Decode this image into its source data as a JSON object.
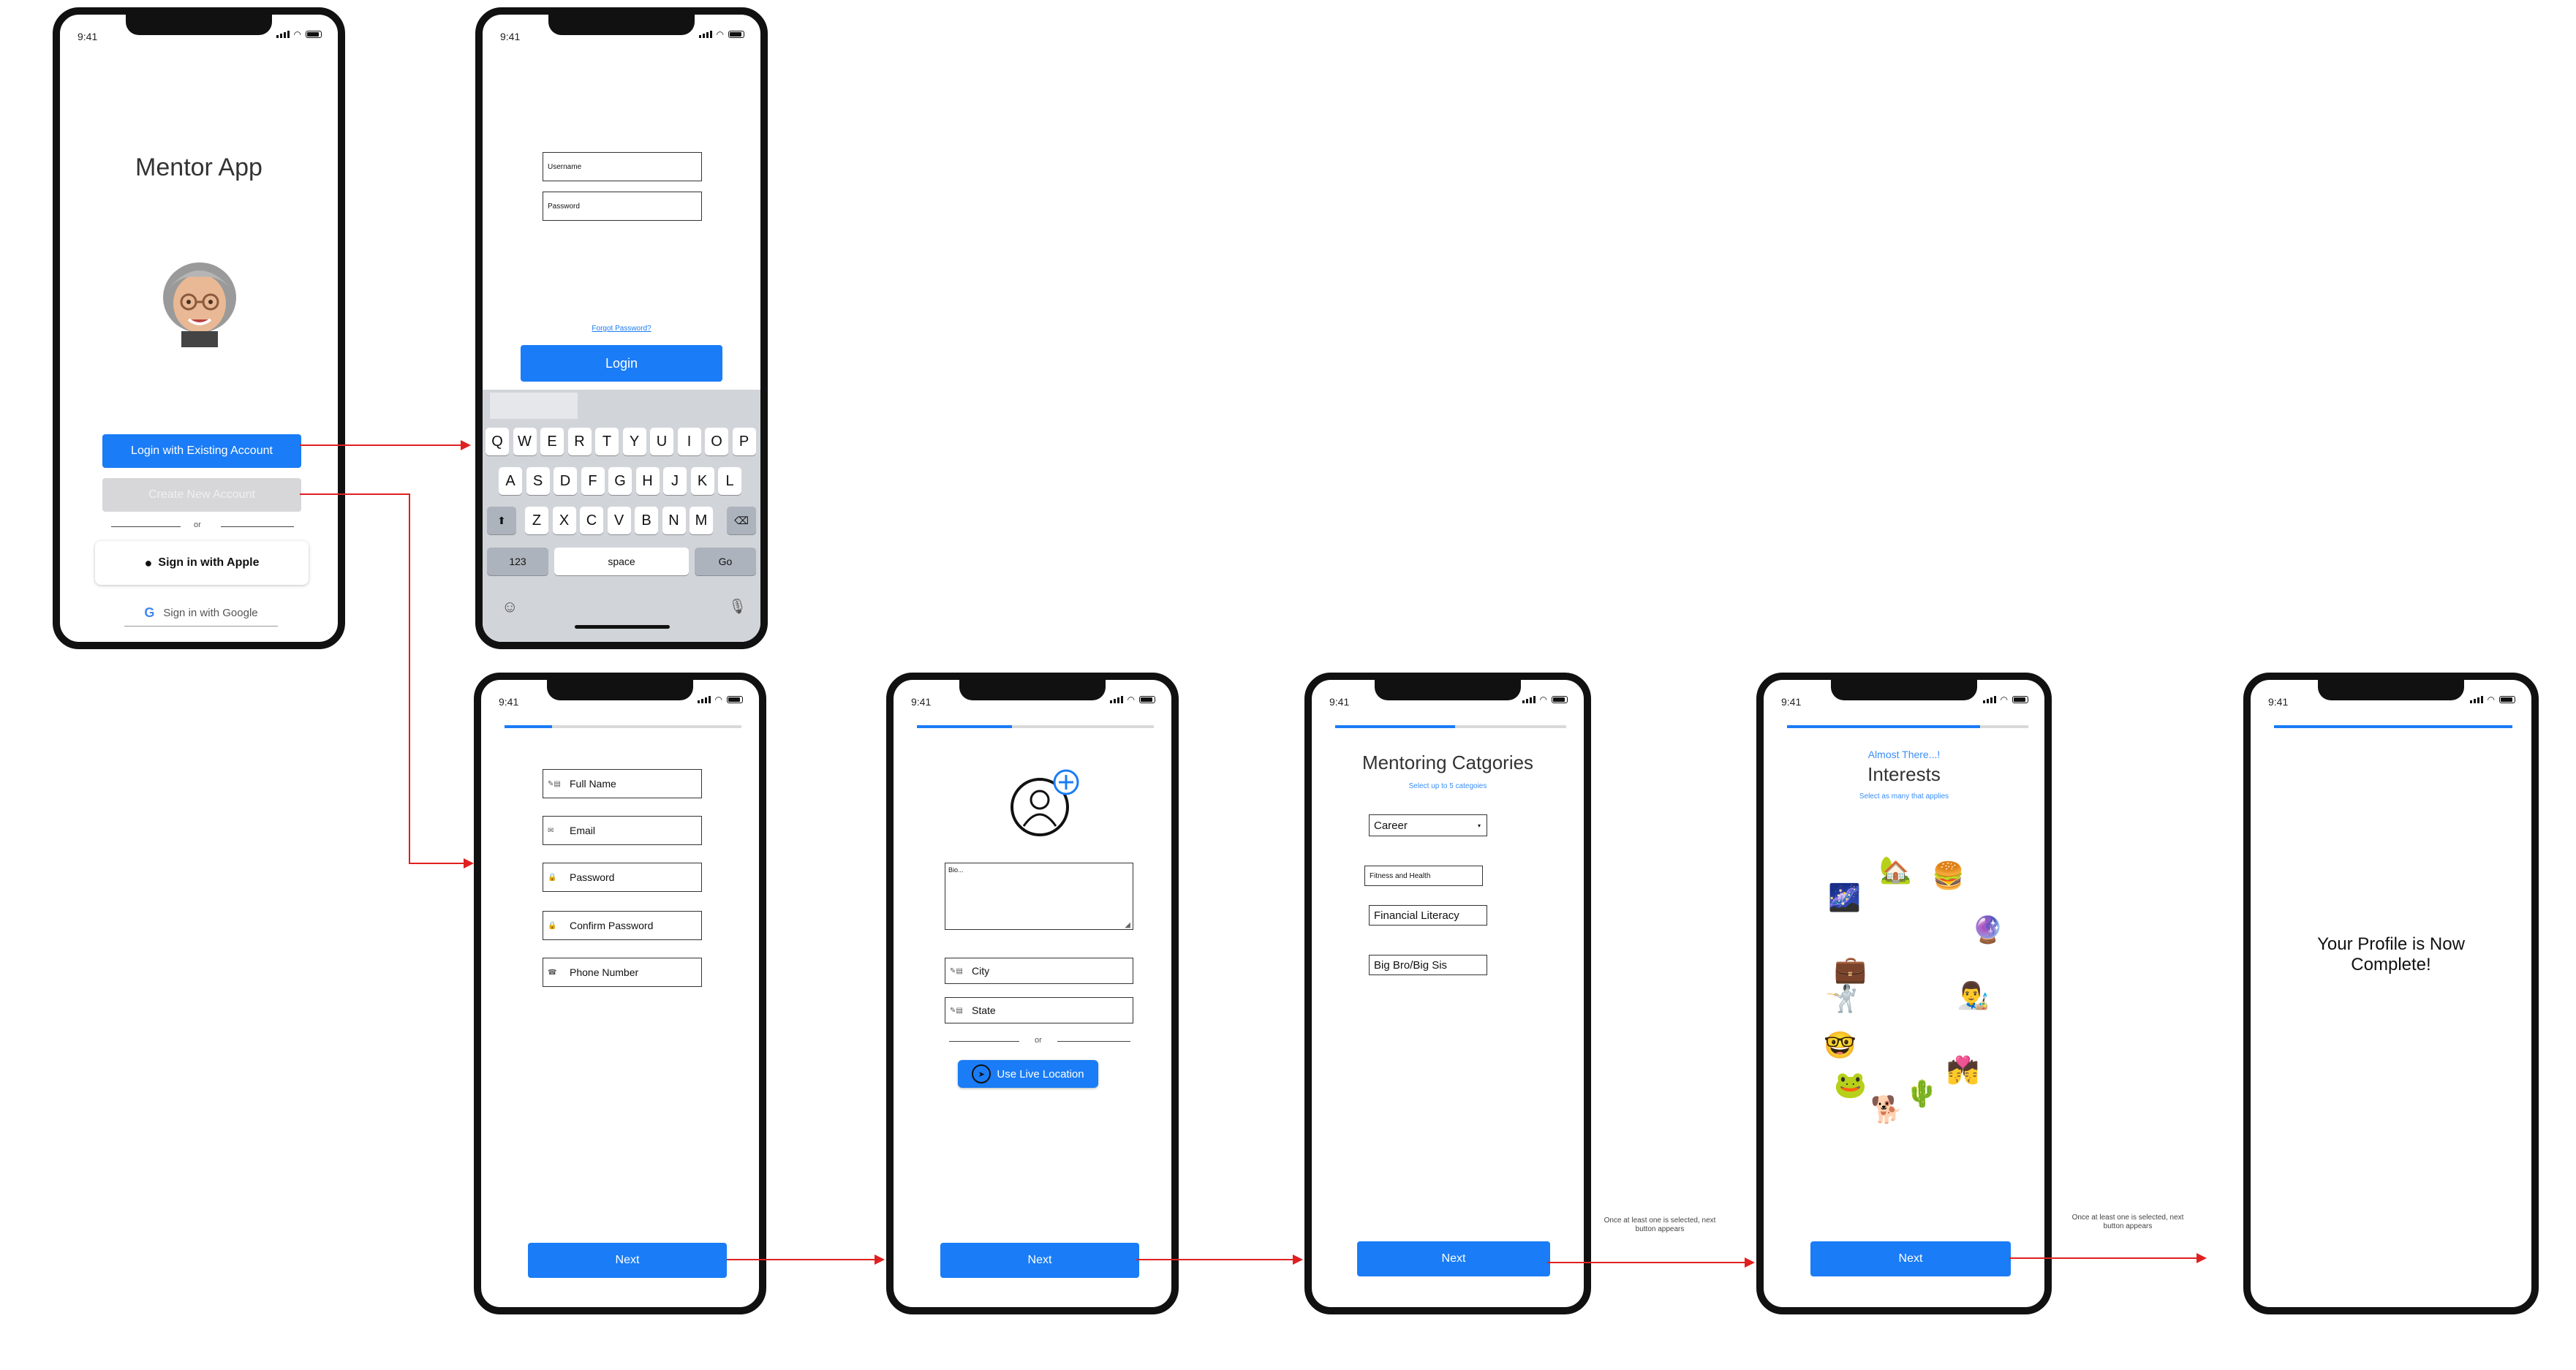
{
  "status": {
    "time": "9:41"
  },
  "welcome": {
    "title": "Mentor App",
    "login_existing": "Login with Existing Account",
    "create_account": "Create New Account",
    "or": "or",
    "apple": "Sign in with Apple",
    "google": "Sign in with Google"
  },
  "login": {
    "username_placeholder": "Username",
    "password_placeholder": "Password",
    "forgot": "Forgot Password?",
    "login_button": "Login"
  },
  "keyboard": {
    "row1": [
      "Q",
      "W",
      "E",
      "R",
      "T",
      "Y",
      "U",
      "I",
      "O",
      "P"
    ],
    "row2": [
      "A",
      "S",
      "D",
      "F",
      "G",
      "H",
      "J",
      "K",
      "L"
    ],
    "row3": [
      "Z",
      "X",
      "C",
      "V",
      "B",
      "N",
      "M"
    ],
    "numbers": "123",
    "space": "space",
    "go": "Go"
  },
  "signup": {
    "full_name": "Full Name",
    "email": "Email",
    "password": "Password",
    "confirm_password": "Confirm Password",
    "phone": "Phone Number",
    "next": "Next"
  },
  "profile": {
    "bio_placeholder": "Bio...",
    "city": "City",
    "state": "State",
    "or": "or",
    "live_location": "Use Live Location",
    "next": "Next"
  },
  "categories": {
    "title": "Mentoring Catgories",
    "subtitle": "Select up to 5 categoies",
    "career": "Career",
    "fitness": "Fitness and Health",
    "financial": "Financial Literacy",
    "bigbro": "Big Bro/Big Sis",
    "next": "Next"
  },
  "interests": {
    "almost": "Almost There...!",
    "title": "Interests",
    "subtitle": "Select as many that applies",
    "next": "Next",
    "emojis": [
      "🌌",
      "🏡",
      "🍔",
      "🔮",
      "💼",
      "🤺",
      "👨‍🎨",
      "🤓",
      "🐸",
      "🐕",
      "🌵",
      "💏"
    ]
  },
  "notes": {
    "note1": "Once at least one is selected, next button appears",
    "note2": "Once at least one is selected, next button appears"
  },
  "complete": {
    "message": "Your Profile is Now Complete!"
  },
  "colors": {
    "accent": "#1a7cf6",
    "arrow": "#e02020"
  }
}
